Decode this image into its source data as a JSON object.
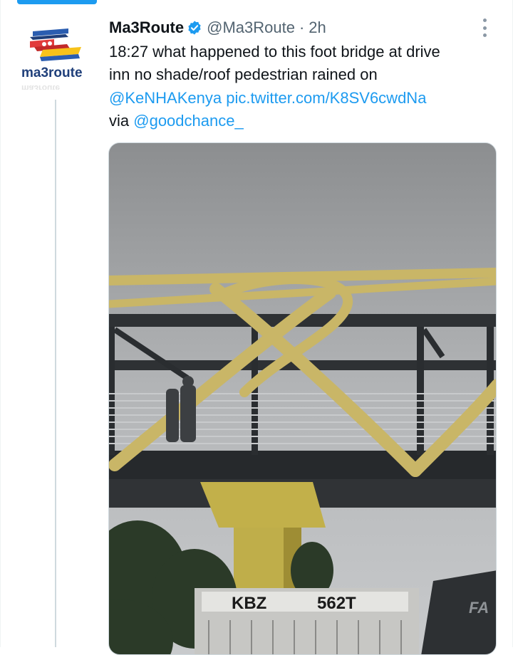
{
  "tweet": {
    "display_name": "Ma3Route",
    "handle": "@Ma3Route",
    "separator": "·",
    "time": "2h",
    "text_line1": "18:27 what happened to this foot bridge at drive",
    "text_line2": "inn no shade/roof pedestrian rained on",
    "mention1": "@KeNHAKenya",
    "link": "pic.twitter.com/K8SV6cwdNa",
    "via": "via",
    "mention2": "@goodchance_"
  },
  "avatar": {
    "logo_text": "ma3route"
  },
  "photo": {
    "plate_left": "KBZ",
    "plate_right": "562T",
    "truck_text": "FA"
  },
  "colors": {
    "accent": "#1d9bf0",
    "text": "#0f1419",
    "secondary": "#536471"
  },
  "icons": [
    "verified-badge-icon",
    "more-options-icon"
  ]
}
